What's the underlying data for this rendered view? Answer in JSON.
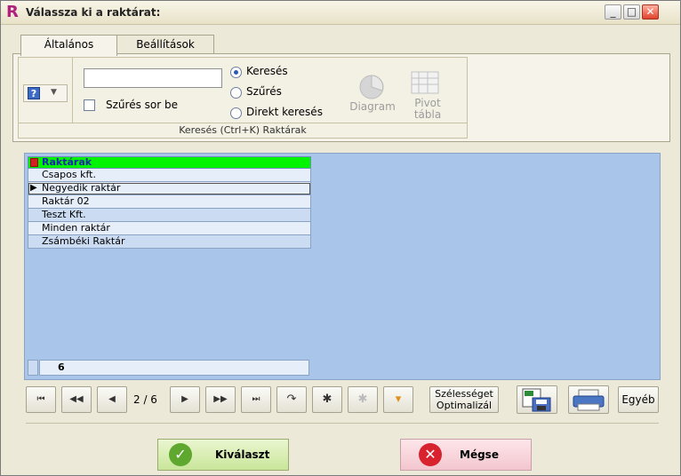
{
  "window": {
    "title": "Válassza ki a raktárat:",
    "app_letter": "R",
    "minimize": "_",
    "maximize": "□",
    "close": "✕"
  },
  "tabs": [
    {
      "label": "Általános",
      "active": true
    },
    {
      "label": "Beállítások",
      "active": false
    }
  ],
  "ribbon": {
    "search_value": "",
    "filter_checkbox_label": "Szűrés sor be",
    "radios": [
      {
        "label": "Keresés",
        "selected": true
      },
      {
        "label": "Szűrés",
        "selected": false
      },
      {
        "label": "Direkt keresés",
        "selected": false
      }
    ],
    "diagram_label": "Diagram",
    "pivot_label_1": "Pivot",
    "pivot_label_2": "tábla",
    "group_footer": "Keresés (Ctrl+K) Raktárak"
  },
  "grid": {
    "header": "Raktárak",
    "rows": [
      "Csapos kft.",
      "Negyedik raktár",
      "Raktár 02",
      "Teszt Kft.",
      "Minden raktár",
      "Zsámbéki Raktár"
    ],
    "selected_index": 1,
    "count": "6"
  },
  "navigator": {
    "position": "2 / 6",
    "first": "⏮",
    "prev_page": "◀◀",
    "prev": "◀",
    "next": "▶",
    "next_page": "▶▶",
    "last": "⏭",
    "refresh": "↷",
    "insert": "✱",
    "delete": "✱",
    "filter": "▾",
    "optimize_line1": "Szélességet",
    "optimize_line2": "Optimalizál",
    "other": "Egyéb"
  },
  "buttons": {
    "ok": "Kiválaszt",
    "cancel": "Mégse"
  },
  "colors": {
    "grid_background": "#a9c6ea",
    "header_green": "#00f400",
    "header_text": "#1a26b0",
    "app_icon": "#b0217d"
  }
}
